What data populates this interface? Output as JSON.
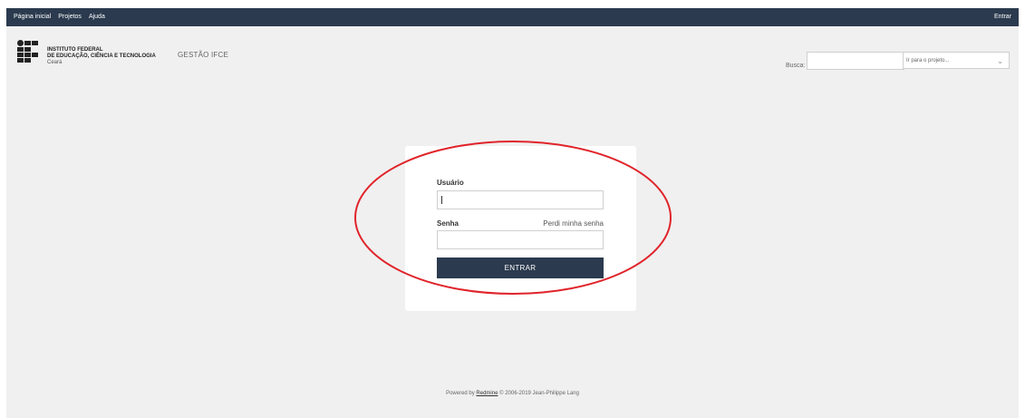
{
  "topbar": {
    "items": [
      "Página inicial",
      "Projetos",
      "Ajuda"
    ],
    "login": "Entrar"
  },
  "header": {
    "logo_line1": "INSTITUTO FEDERAL",
    "logo_line2": "DE EDUCAÇÃO, CIÊNCIA E TECNOLOGIA",
    "logo_line3": "Ceará",
    "project_title": "GESTÃO IFCE",
    "search_label": "Busca:",
    "search_value": "",
    "jump_label": "Ir para o projeto..."
  },
  "login": {
    "username_label": "Usuário",
    "username_value": "",
    "password_label": "Senha",
    "password_value": "",
    "forgot_label": "Perdi minha senha",
    "submit_label": "ENTRAR"
  },
  "footer": {
    "prefix": "Powered by",
    "link": "Redmine",
    "suffix": "© 2006-2019 Jean-Philippe Lang"
  },
  "colors": {
    "topbar": "#2b3a4e",
    "button": "#2b3a4e",
    "background": "#f0f0f0",
    "annotation": "#e0242a"
  }
}
